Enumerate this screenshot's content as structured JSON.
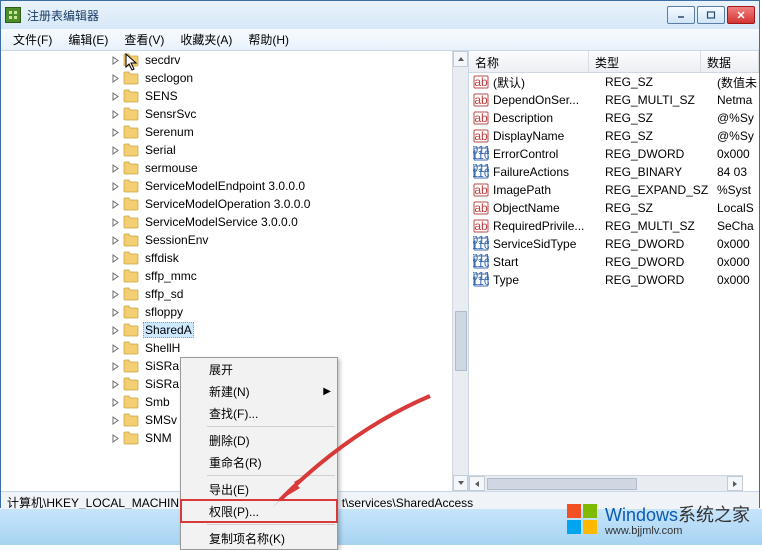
{
  "window": {
    "title": "注册表编辑器"
  },
  "menu": {
    "file": "文件(F)",
    "edit": "编辑(E)",
    "view": "查看(V)",
    "favorites": "收藏夹(A)",
    "help": "帮助(H)"
  },
  "tree": {
    "items": [
      {
        "label": "secdrv"
      },
      {
        "label": "seclogon"
      },
      {
        "label": "SENS"
      },
      {
        "label": "SensrSvc"
      },
      {
        "label": "Serenum"
      },
      {
        "label": "Serial"
      },
      {
        "label": "sermouse"
      },
      {
        "label": "ServiceModelEndpoint 3.0.0.0"
      },
      {
        "label": "ServiceModelOperation 3.0.0.0"
      },
      {
        "label": "ServiceModelService 3.0.0.0"
      },
      {
        "label": "SessionEnv"
      },
      {
        "label": "sffdisk"
      },
      {
        "label": "sffp_mmc"
      },
      {
        "label": "sffp_sd"
      },
      {
        "label": "sfloppy"
      },
      {
        "label": "SharedA",
        "selected": true
      },
      {
        "label": "ShellH"
      },
      {
        "label": "SiSRa"
      },
      {
        "label": "SiSRa"
      },
      {
        "label": "Smb"
      },
      {
        "label": "SMSv"
      },
      {
        "label": "SNM"
      }
    ]
  },
  "list": {
    "columns": {
      "name": "名称",
      "type": "类型",
      "data": "数据"
    },
    "rows": [
      {
        "kind": "sz",
        "name": "(默认)",
        "type": "REG_SZ",
        "data": "(数值未"
      },
      {
        "kind": "sz",
        "name": "DependOnSer...",
        "type": "REG_MULTI_SZ",
        "data": "Netma"
      },
      {
        "kind": "sz",
        "name": "Description",
        "type": "REG_SZ",
        "data": "@%Sy"
      },
      {
        "kind": "sz",
        "name": "DisplayName",
        "type": "REG_SZ",
        "data": "@%Sy"
      },
      {
        "kind": "bin",
        "name": "ErrorControl",
        "type": "REG_DWORD",
        "data": "0x000"
      },
      {
        "kind": "bin",
        "name": "FailureActions",
        "type": "REG_BINARY",
        "data": "84 03"
      },
      {
        "kind": "sz",
        "name": "ImagePath",
        "type": "REG_EXPAND_SZ",
        "data": "%Syst"
      },
      {
        "kind": "sz",
        "name": "ObjectName",
        "type": "REG_SZ",
        "data": "LocalS"
      },
      {
        "kind": "sz",
        "name": "RequiredPrivile...",
        "type": "REG_MULTI_SZ",
        "data": "SeCha"
      },
      {
        "kind": "bin",
        "name": "ServiceSidType",
        "type": "REG_DWORD",
        "data": "0x000"
      },
      {
        "kind": "bin",
        "name": "Start",
        "type": "REG_DWORD",
        "data": "0x000"
      },
      {
        "kind": "bin",
        "name": "Type",
        "type": "REG_DWORD",
        "data": "0x000"
      }
    ]
  },
  "status": {
    "path_left": "计算机\\HKEY_LOCAL_MACHIN",
    "path_right": "t\\services\\SharedAccess"
  },
  "context_menu": {
    "expand": "展开",
    "new": "新建(N)",
    "find": "查找(F)...",
    "delete": "删除(D)",
    "rename": "重命名(R)",
    "export": "导出(E)",
    "permissions": "权限(P)...",
    "copy_key_name": "复制项名称(K)"
  },
  "watermark": {
    "brand": "Windows",
    "brand2": "系统之家",
    "url": "www.bjjmlv.com"
  }
}
